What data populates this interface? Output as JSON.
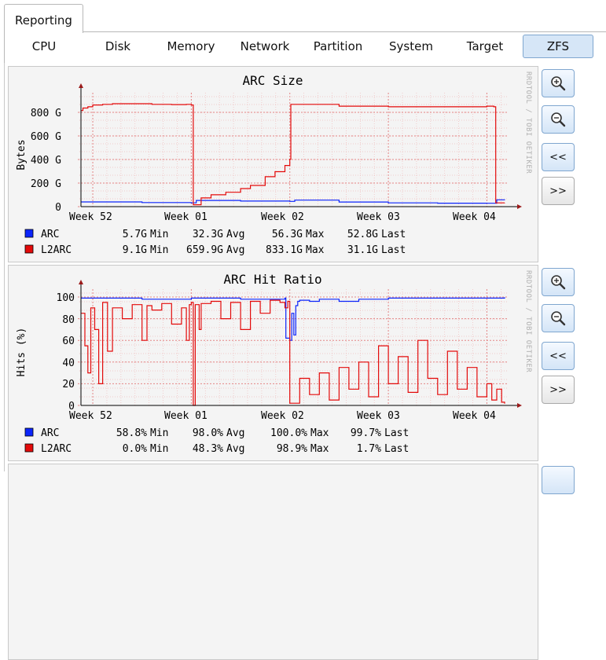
{
  "outer_tab": {
    "label": "Reporting"
  },
  "tabs": [
    {
      "label": "CPU"
    },
    {
      "label": "Disk"
    },
    {
      "label": "Memory"
    },
    {
      "label": "Network"
    },
    {
      "label": "Partition"
    },
    {
      "label": "System"
    },
    {
      "label": "Target"
    },
    {
      "label": "ZFS",
      "active": true
    }
  ],
  "side_text": "RRDTOOL / TOBI OETIKER",
  "controls": {
    "zoom_in_icon": "zoom-in-icon",
    "zoom_out_icon": "zoom-out-icon",
    "back_label": "<<",
    "forward_label": ">>"
  },
  "colors": {
    "arc": "#0b24fb",
    "l2arc": "#e30a0a",
    "grid_minor": "#f0bcbc",
    "grid_major": "#e38585",
    "active_tab": "#d6e6f7"
  },
  "graphs": [
    {
      "title": "ARC Size",
      "ylabel": "Bytes",
      "yticks": [
        "0",
        "200 G",
        "400 G",
        "600 G",
        "800 G"
      ],
      "xticks": [
        "Week 52",
        "Week 01",
        "Week 02",
        "Week 03",
        "Week 04"
      ],
      "legend": [
        {
          "name": "ARC",
          "min": "5.7G",
          "avg": "32.3G",
          "max": "56.3G",
          "last": "52.8G"
        },
        {
          "name": "L2ARC",
          "min": "9.1G",
          "avg": "659.9G",
          "max": "833.1G",
          "last": "31.1G"
        }
      ]
    },
    {
      "title": "ARC Hit Ratio",
      "ylabel": "Hits (%)",
      "yticks": [
        "0",
        "20",
        "40",
        "60",
        "80",
        "100"
      ],
      "xticks": [
        "Week 52",
        "Week 01",
        "Week 02",
        "Week 03",
        "Week 04"
      ],
      "legend": [
        {
          "name": "ARC",
          "min": "58.8%",
          "avg": "98.0%",
          "max": "100.0%",
          "last": "99.7%"
        },
        {
          "name": "L2ARC",
          "min": "0.0%",
          "avg": "48.3%",
          "max": "98.9%",
          "last": "1.7%"
        }
      ]
    }
  ],
  "legend_words": {
    "min": "Min",
    "avg": "Avg",
    "max": "Max",
    "last": "Last"
  },
  "chart_data": [
    {
      "type": "line",
      "title": "ARC Size",
      "ylabel": "Bytes",
      "ylim": [
        0,
        850
      ],
      "x_range": [
        -0.12,
        4.18
      ],
      "x_unit": "weeks since Week 52",
      "series": [
        {
          "name": "ARC",
          "x": [
            -0.12,
            0.5,
            1.0,
            1.05,
            1.5,
            2.0,
            2.05,
            2.5,
            3.0,
            3.5,
            4.0,
            4.1,
            4.18
          ],
          "values": [
            38,
            33,
            30,
            50,
            45,
            42,
            52,
            37,
            30,
            28,
            27,
            55,
            52
          ]
        },
        {
          "name": "L2ARC",
          "x": [
            -0.12,
            -0.1,
            -0.05,
            0.0,
            0.1,
            0.2,
            0.4,
            0.6,
            0.8,
            0.95,
            1.0,
            1.02,
            1.1,
            1.2,
            1.35,
            1.5,
            1.6,
            1.75,
            1.85,
            1.95,
            2.0,
            2.01,
            2.5,
            3.0,
            3.5,
            4.0,
            4.07,
            4.09,
            4.18
          ],
          "values": [
            770,
            790,
            800,
            815,
            820,
            825,
            825,
            820,
            818,
            820,
            815,
            15,
            70,
            95,
            115,
            145,
            170,
            240,
            280,
            330,
            380,
            820,
            805,
            800,
            800,
            805,
            800,
            30,
            31
          ]
        }
      ]
    },
    {
      "type": "line",
      "title": "ARC Hit Ratio",
      "ylabel": "Hits (%)",
      "ylim": [
        0,
        100
      ],
      "x_range": [
        -0.12,
        4.18
      ],
      "series": [
        {
          "name": "ARC",
          "x": [
            -0.12,
            0.5,
            1.0,
            1.5,
            1.95,
            1.96,
            2.0,
            2.02,
            2.04,
            2.06,
            2.08,
            2.1,
            2.2,
            2.3,
            2.5,
            2.7,
            3.0,
            3.5,
            4.0,
            4.18
          ],
          "values": [
            99,
            98,
            99,
            98,
            99,
            62,
            60,
            85,
            65,
            92,
            96,
            97,
            96,
            98,
            96,
            98,
            99,
            99,
            99,
            99.7
          ]
        },
        {
          "name": "L2ARC",
          "x": [
            -0.12,
            -0.08,
            -0.05,
            -0.02,
            0.02,
            0.06,
            0.1,
            0.15,
            0.2,
            0.3,
            0.4,
            0.5,
            0.55,
            0.6,
            0.7,
            0.8,
            0.9,
            0.95,
            0.98,
            1.0,
            1.02,
            1.04,
            1.08,
            1.1,
            1.2,
            1.3,
            1.4,
            1.5,
            1.6,
            1.7,
            1.8,
            1.9,
            1.95,
            1.98,
            2.0,
            2.1,
            2.2,
            2.3,
            2.4,
            2.5,
            2.6,
            2.7,
            2.8,
            2.9,
            3.0,
            3.1,
            3.2,
            3.3,
            3.4,
            3.5,
            3.6,
            3.7,
            3.8,
            3.9,
            4.0,
            4.05,
            4.1,
            4.15,
            4.18
          ],
          "values": [
            85,
            55,
            30,
            90,
            70,
            20,
            95,
            50,
            90,
            80,
            93,
            60,
            92,
            88,
            94,
            75,
            90,
            60,
            93,
            95,
            0,
            93,
            70,
            94,
            96,
            80,
            95,
            70,
            96,
            85,
            97,
            95,
            90,
            96,
            2,
            25,
            10,
            30,
            5,
            35,
            15,
            40,
            8,
            55,
            20,
            45,
            12,
            60,
            25,
            10,
            50,
            15,
            35,
            8,
            20,
            5,
            15,
            3,
            1.7
          ]
        }
      ]
    }
  ]
}
